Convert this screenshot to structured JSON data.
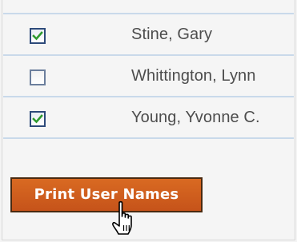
{
  "users": [
    {
      "name": "Stine, Gary",
      "checked": true
    },
    {
      "name": "Whittington, Lynn",
      "checked": false
    },
    {
      "name": "Young, Yvonne C.",
      "checked": true
    }
  ],
  "actions": {
    "print_label": "Print User Names"
  },
  "colors": {
    "button_bg": "#c95a1c",
    "check_green": "#2f9a2f",
    "row_divider": "#c9d9ea",
    "name_text": "#4d4d4d"
  },
  "cursor": {
    "icon": "hand-pointer-icon"
  }
}
